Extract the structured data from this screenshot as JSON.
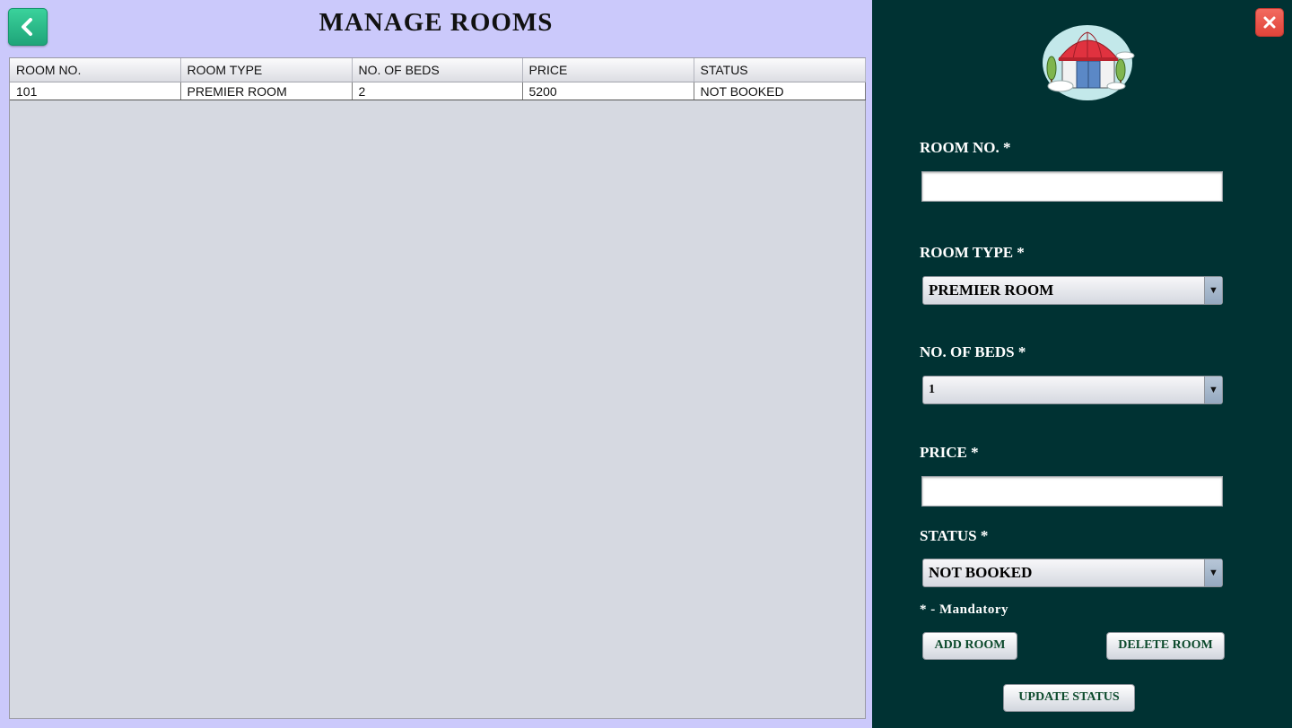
{
  "page_title": "MANAGE ROOMS",
  "table": {
    "columns": [
      "ROOM NO.",
      "ROOM TYPE",
      "NO. OF BEDS",
      "PRICE",
      "STATUS"
    ],
    "rows": [
      [
        "101",
        "PREMIER ROOM",
        "2",
        "5200",
        "NOT BOOKED"
      ]
    ]
  },
  "form": {
    "room_no_label": "ROOM NO. *",
    "room_no_value": "",
    "room_type_label": "ROOM TYPE *",
    "room_type_value": "PREMIER ROOM",
    "beds_label": "NO. OF BEDS *",
    "beds_value": "1",
    "price_label": "PRICE *",
    "price_value": "",
    "status_label": "STATUS *",
    "status_value": "NOT BOOKED",
    "mandatory_note": "* - Mandatory"
  },
  "buttons": {
    "add": "ADD ROOM",
    "delete": "DELETE ROOM",
    "update": "UPDATE STATUS"
  },
  "icons": {
    "back": "chevron-left-icon",
    "close": "close-icon",
    "logo": "hotel-building-icon"
  },
  "colors": {
    "left_bg": "#cbc9fb",
    "right_bg": "#003233",
    "back_button": "#2cc08d",
    "close_button": "#e8534a"
  }
}
